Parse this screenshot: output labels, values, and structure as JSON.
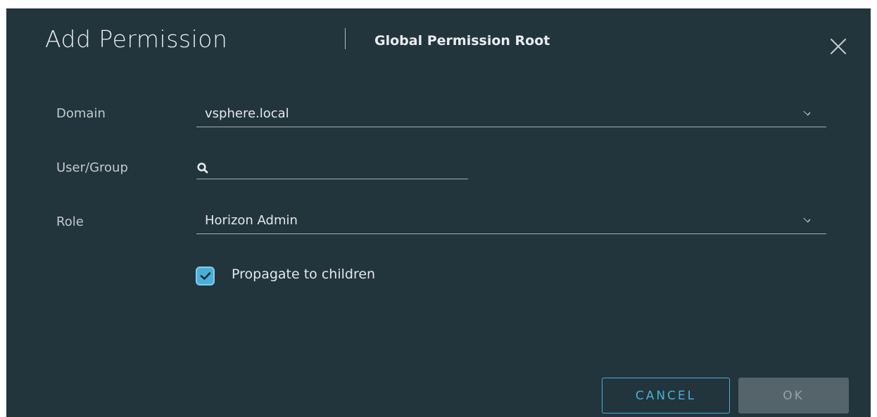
{
  "dialog": {
    "title": "Add Permission",
    "subtitle": "Global Permission Root",
    "close_icon": "close-icon"
  },
  "form": {
    "domain": {
      "label": "Domain",
      "value": "vsphere.local"
    },
    "user_group": {
      "label": "User/Group",
      "value": "",
      "icon": "search-icon"
    },
    "role": {
      "label": "Role",
      "value": "Horizon Admin"
    },
    "propagate": {
      "label": "Propagate to children",
      "checked": true
    }
  },
  "buttons": {
    "cancel": "CANCEL",
    "ok": "OK"
  },
  "colors": {
    "background": "#22343c",
    "accent": "#49afd9",
    "ok_disabled": "#55646b"
  }
}
